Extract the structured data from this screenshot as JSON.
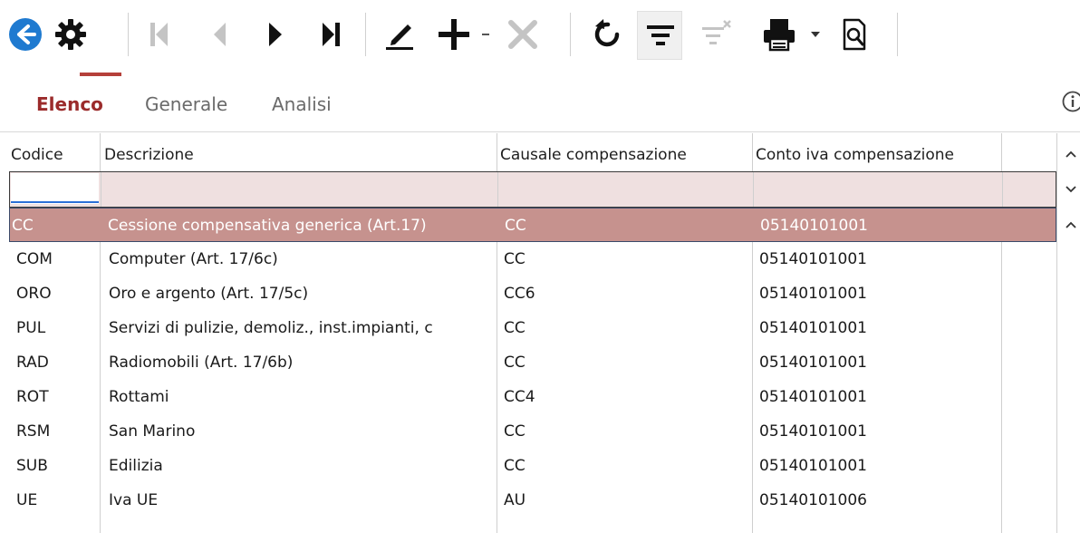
{
  "toolbar": {
    "icons": [
      "back-icon",
      "gear-icon",
      "first-record-icon",
      "previous-record-icon",
      "next-record-icon",
      "last-record-icon",
      "edit-icon",
      "add-icon",
      "add-dropdown-icon",
      "delete-icon",
      "refresh-icon",
      "filter-icon",
      "clear-filter-icon",
      "print-icon",
      "print-dropdown-icon",
      "print-preview-icon"
    ],
    "accent": "#b5403a"
  },
  "tabs": [
    {
      "label": "Elenco",
      "active": true
    },
    {
      "label": "Generale",
      "active": false
    },
    {
      "label": "Analisi",
      "active": false
    }
  ],
  "grid": {
    "columns": [
      "Codice",
      "Descrizione",
      "Causale compensazione",
      "Conto iva compensazione"
    ],
    "filter_values": [
      "",
      "",
      "",
      ""
    ],
    "rows": [
      {
        "codice": "CC",
        "descrizione": "Cessione compensativa generica (Art.17)",
        "causale": "CC",
        "conto": "05140101001",
        "selected": true
      },
      {
        "codice": "COM",
        "descrizione": "Computer (Art. 17/6c)",
        "causale": "CC",
        "conto": "05140101001"
      },
      {
        "codice": "ORO",
        "descrizione": "Oro e argento (Art. 17/5c)",
        "causale": "CC6",
        "conto": "05140101001"
      },
      {
        "codice": "PUL",
        "descrizione": "Servizi di pulizie, demoliz., inst.impianti, c",
        "causale": "CC",
        "conto": "05140101001"
      },
      {
        "codice": "RAD",
        "descrizione": "Radiomobili (Art. 17/6b)",
        "causale": "CC",
        "conto": "05140101001"
      },
      {
        "codice": "ROT",
        "descrizione": "Rottami",
        "causale": "CC4",
        "conto": "05140101001"
      },
      {
        "codice": "RSM",
        "descrizione": "San Marino",
        "causale": "CC",
        "conto": "05140101001"
      },
      {
        "codice": "SUB",
        "descrizione": "Edilizia",
        "causale": "CC",
        "conto": "05140101001"
      },
      {
        "codice": "UE",
        "descrizione": "Iva UE",
        "causale": "AU",
        "conto": "05140101006"
      }
    ],
    "selected_color": "#c6928e",
    "filter_color": "#efe0e0"
  }
}
